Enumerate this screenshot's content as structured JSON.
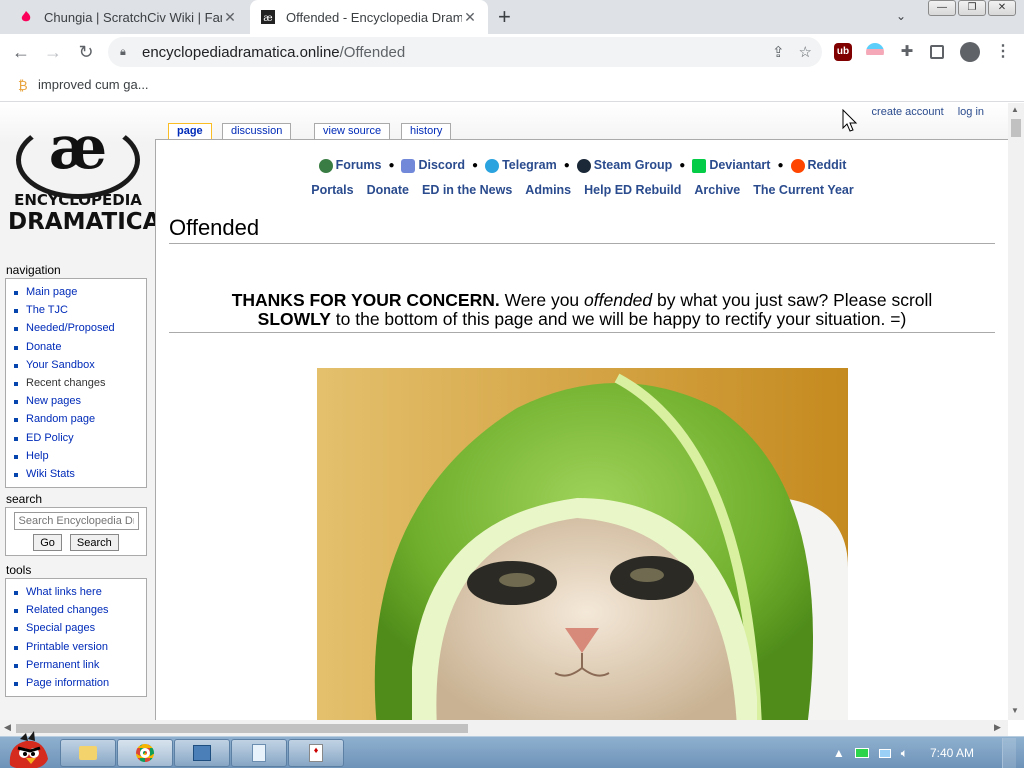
{
  "browser": {
    "tabs": [
      {
        "title": "Chungia | ScratchCiv Wiki | Fandom",
        "active": false
      },
      {
        "title": "Offended - Encyclopedia Dramatica",
        "active": true
      }
    ],
    "url_domain": "encyclopediadramatica.online",
    "url_path": "/Offended",
    "bookmarks": [
      {
        "label": "improved cum ga..."
      }
    ],
    "window_buttons": {
      "minimize": "—",
      "restore": "❐",
      "close": "✕"
    }
  },
  "page": {
    "personal_links": {
      "create_account": "create account",
      "log_in": "log in"
    },
    "logo": {
      "symbol": "æ",
      "line1": "ENCYCLOPEDIA",
      "line2": "DRAMATICA"
    },
    "tabs": {
      "page": "page",
      "discussion": "discussion",
      "view_source": "view source",
      "history": "history"
    },
    "topnav": {
      "row1": [
        "Forums",
        "Discord",
        "Telegram",
        "Steam Group",
        "Deviantart",
        "Reddit"
      ],
      "row2": [
        "Portals",
        "Donate",
        "ED in the News",
        "Admins",
        "Help ED Rebuild",
        "Archive",
        "The Current Year"
      ],
      "bullet": "●"
    },
    "title": "Offended",
    "notice": {
      "bold1": "THANKS FOR YOUR CONCERN.",
      "text1": " Were you ",
      "italic": "offended",
      "text2": " by what you just saw? Please scroll",
      "bold2": "SLOWLY",
      "text3": " to the bottom of this page and we will be happy to rectify your situation. =)"
    }
  },
  "sidebar": {
    "navigation": {
      "heading": "navigation",
      "items": [
        "Main page",
        "The TJC",
        "Needed/Proposed",
        "Donate",
        "Your Sandbox",
        "Recent changes",
        "New pages",
        "Random page",
        "ED Policy",
        "Help",
        "Wiki Stats"
      ]
    },
    "search": {
      "heading": "search",
      "placeholder": "Search Encyclopedia Dramatica",
      "go": "Go",
      "search": "Search"
    },
    "tools": {
      "heading": "tools",
      "items": [
        "What links here",
        "Related changes",
        "Special pages",
        "Printable version",
        "Permanent link",
        "Page information"
      ]
    }
  },
  "taskbar": {
    "clock": "7:40 AM"
  },
  "colors": {
    "link": "#002bb8",
    "tab_selected_border": "#fabd23",
    "taskbar": "#7fa1c4"
  }
}
